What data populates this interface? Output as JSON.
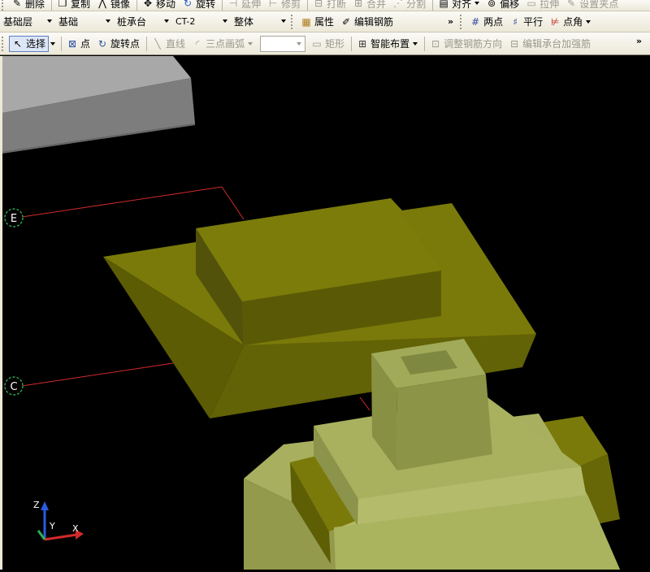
{
  "toolbar_top": {
    "delete_label": "删除",
    "copy_label": "复制",
    "mirror_label": "镜像",
    "move_label": "移动",
    "rotate_label": "旋转",
    "extend_label": "延伸",
    "trim_label": "修剪",
    "break_label": "打断",
    "merge_label": "合并",
    "split_label": "分割",
    "align_label": "对齐",
    "offset_label": "偏移",
    "stretch_label": "拉伸",
    "set_point_label": "设置夹点"
  },
  "toolbar_mid": {
    "floor_value": "基础层",
    "category_value": "基础",
    "component_type_value": "桩承台",
    "component_name_value": "CT-2",
    "scope_value": "整体",
    "properties_label": "属性",
    "edit_rebar_label": "编辑钢筋",
    "two_point_label": "两点",
    "parallel_label": "平行",
    "point_angle_label": "点角"
  },
  "toolbar_bottom": {
    "select_label": "选择",
    "point_label": "点",
    "rotate_point_label": "旋转点",
    "line_label": "直线",
    "arc_label": "三点画弧",
    "rect_label": "矩形",
    "smart_layout_label": "智能布置",
    "adjust_rebar_dir_label": "调整钢筋方向",
    "edit_cap_rebar_label": "编辑承台加强筋"
  },
  "viewport": {
    "axis_e_label": "E",
    "axis_c_label": "C",
    "gizmo_z_label": "Z",
    "gizmo_y_label": "Y",
    "gizmo_x_label": "X"
  },
  "colors": {
    "background": "#000000",
    "pile_cap": "#7a7a0a",
    "pile_cap_light": "#9e9e3c",
    "grid_line": "#d22a2a",
    "axis_bubble": "#2fa04a"
  }
}
